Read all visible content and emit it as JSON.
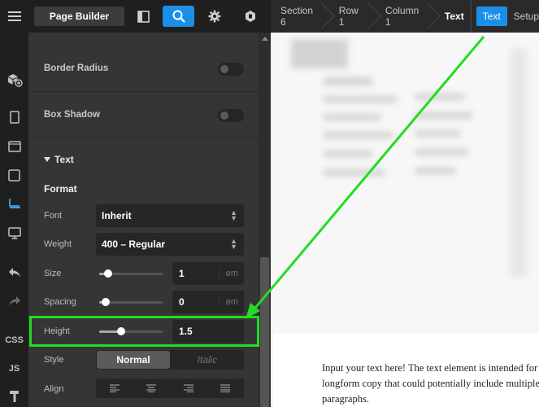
{
  "topbar": {
    "page_builder_label": "Page Builder",
    "breadcrumbs": [
      "Section 6",
      "Row 1",
      "Column 1",
      "Text"
    ],
    "tabs": {
      "text": "Text",
      "setup": "Setup"
    },
    "accent_color": "#1a8fe8"
  },
  "rail": {
    "items": [
      "hamburger-icon",
      "boxes-add-icon",
      "page-icon",
      "window-icon",
      "square-icon",
      "row-selected-icon",
      "monitor-icon",
      "undo-icon",
      "redo-icon"
    ],
    "css_label": "CSS",
    "js_label": "JS"
  },
  "panel": {
    "border_radius_label": "Border Radius",
    "box_shadow_label": "Box Shadow",
    "text_section_label": "Text",
    "format_label": "Format",
    "font": {
      "label": "Font",
      "value": "Inherit"
    },
    "weight": {
      "label": "Weight",
      "value": "400 – Regular"
    },
    "size": {
      "label": "Size",
      "value": "1",
      "unit": "em",
      "slider_level": 0.14
    },
    "spacing": {
      "label": "Spacing",
      "value": "0",
      "unit": "em",
      "slider_level": 0.1
    },
    "height": {
      "label": "Height",
      "value": "1.5",
      "slider_level": 0.34
    },
    "style": {
      "label": "Style",
      "options": [
        "Normal",
        "Italic"
      ],
      "selected": "Normal"
    },
    "align": {
      "label": "Align",
      "options": [
        "align-left-icon",
        "align-center-icon",
        "align-right-icon",
        "align-justify-icon"
      ]
    }
  },
  "annotation": {
    "highlight_color": "#22dd22"
  },
  "preview": {
    "text": "Input your text here! The text element is intended for longform copy that could potentially include multiple paragraphs."
  }
}
